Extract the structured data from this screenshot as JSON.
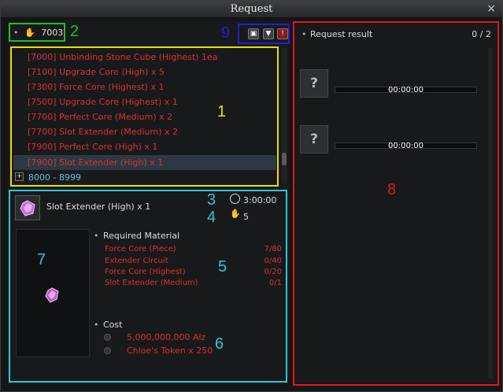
{
  "window": {
    "title": "Request",
    "close_glyph": "×"
  },
  "left_top": {
    "token_count": "7003",
    "token_icon": "hand-coin-icon"
  },
  "list": {
    "items": [
      "[7000] Unbinding Stone Cube (Highest) 1ea",
      "[7100] Upgrade Core (High) x 5",
      "[7300] Force Core (Highest) x 1",
      "[7500] Upgrade Core (Highest) x 1",
      "[7700] Perfect Core (Medium) x 2",
      "[7700] Slot Extender (Medium) x 2",
      "[7900] Perfect Core (High) x 1",
      "[7900] Slot Extender (High) x 1"
    ],
    "group_label": "8000 - 8999",
    "group_toggle": "+"
  },
  "detail": {
    "item_name": "Slot Extender (High) x 1",
    "time": "3:00:00",
    "reward": "5",
    "required_heading": "Required Material",
    "materials": [
      {
        "name": "Force Core (Piece)",
        "qty": "7/80"
      },
      {
        "name": "Extender Circuit",
        "qty": "0/40"
      },
      {
        "name": "Force Core (Highest)",
        "qty": "0/20"
      },
      {
        "name": "Slot Extender (Medium)",
        "qty": "0/1"
      }
    ],
    "cost_heading": "Cost",
    "costs": [
      "5,000,000,000 Alz",
      "Chloe's Token x 250"
    ]
  },
  "right": {
    "heading": "Request result",
    "count": "0 / 2",
    "slots": [
      {
        "glyph": "?",
        "timer": "00:00:00"
      },
      {
        "glyph": "?",
        "timer": "00:00:00"
      }
    ]
  },
  "annotations": {
    "n1": "1",
    "n2": "2",
    "n3": "3",
    "n4": "4",
    "n5": "5",
    "n6": "6",
    "n7": "7",
    "n8": "8",
    "n9": "9"
  },
  "colors": {
    "yellow": "#e8e000",
    "green": "#20c020",
    "cyan": "#28c8d8",
    "blue": "#2020d0",
    "red": "#e01818"
  }
}
